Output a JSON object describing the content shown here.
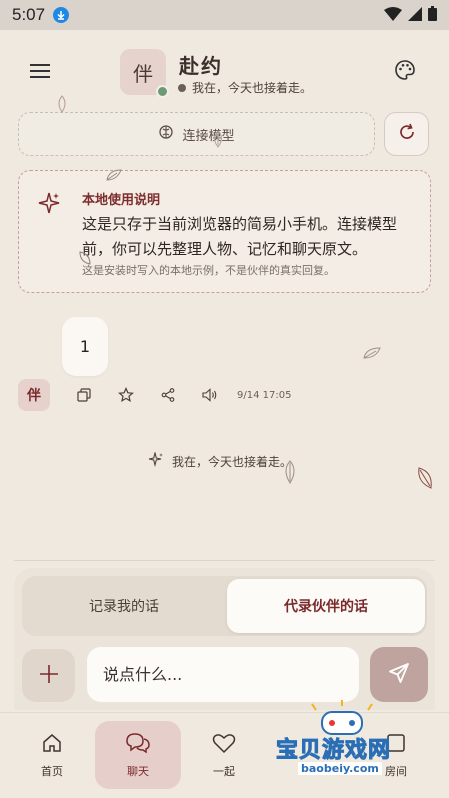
{
  "status_bar": {
    "time": "5:07"
  },
  "header": {
    "avatar_char": "伴",
    "title": "赴约",
    "subtitle": "我在，今天也接着走。"
  },
  "connect": {
    "label": "连接模型"
  },
  "notice": {
    "title": "本地使用说明",
    "body": "这是只存于当前浏览器的简易小手机。连接模型前，你可以先整理人物、记忆和聊天原文。",
    "footnote": "这是安装时写入的本地示例，不是伙伴的真实回复。"
  },
  "message": {
    "text": "1",
    "avatar_char": "伴",
    "time": "9/14 17:05"
  },
  "typing_status": "我在，今天也接着走。",
  "composer": {
    "tab_left": "记录我的话",
    "tab_right": "代录伙伴的话",
    "placeholder": "说点什么..."
  },
  "nav": {
    "home": "首页",
    "chat": "聊天",
    "together": "一起",
    "room": "房间"
  },
  "watermark": {
    "main": "宝贝游戏网",
    "sub": "baobeiy.com"
  },
  "colors": {
    "accent": "#7a2a2c",
    "background": "#efe9df",
    "online": "#6c9a72",
    "send": "#bfa39e"
  }
}
